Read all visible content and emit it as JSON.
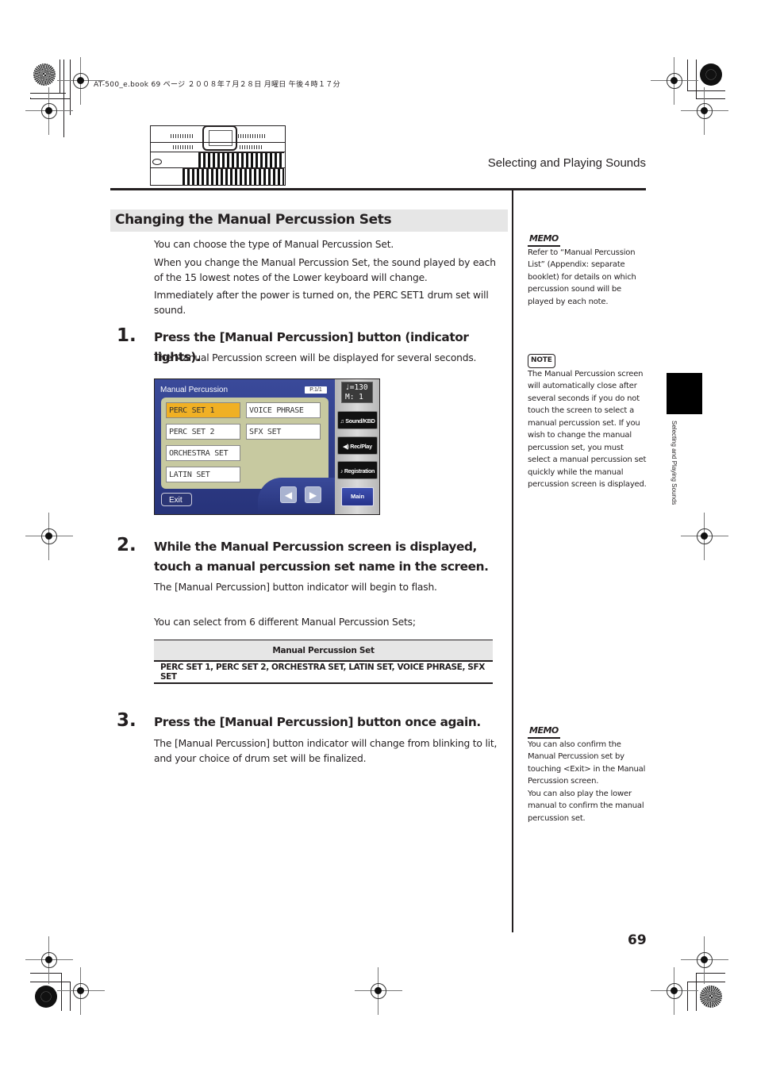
{
  "print_header": {
    "info": "AT-500_e.book  69 ページ  ２００８年７月２８日  月曜日  午後４時１７分"
  },
  "running_head": "Selecting and Playing Sounds",
  "section": {
    "title": "Changing the Manual Percussion Sets",
    "intro": [
      "You can choose the type of Manual Percussion Set.",
      "When you change the Manual Percussion Set, the sound played by each of the 15 lowest notes of the Lower keyboard will change.",
      "Immediately after the power is turned on, the PERC SET1 drum set will sound."
    ]
  },
  "steps": [
    {
      "number": "1.",
      "title": "Press the [Manual Percussion] button (indicator lights).",
      "body": "The Manual Percussion screen will be displayed for several seconds."
    },
    {
      "number": "2.",
      "title": "While the Manual Percussion screen is displayed, touch a manual percussion set name in the screen.",
      "body": "The [Manual Percussion] button indicator will begin to flash.",
      "extra": "You can select from 6 different Manual Percussion Sets;"
    },
    {
      "number": "3.",
      "title": "Press the [Manual Percussion] button once again.",
      "body": "The [Manual Percussion] button indicator will change from blinking to lit, and your choice of drum set will be finalized."
    }
  ],
  "screen": {
    "title": "Manual Percussion",
    "page": "P.1/1",
    "sets_left": [
      "PERC SET 1",
      "PERC SET 2",
      "ORCHESTRA SET",
      "LATIN SET"
    ],
    "sets_right": [
      "VOICE PHRASE",
      "SFX SET"
    ],
    "selected": "PERC SET 1",
    "exit_label": "Exit",
    "prev_icon": "◀",
    "next_icon": "▶",
    "tempo_line": "♩=130",
    "measure_line": "M:   1",
    "side_buttons": [
      "♫ Sound/KBD",
      "◀) Rec/Play",
      "♪ Registration"
    ],
    "main_label": "Main",
    "selected_color": "#f0b024"
  },
  "table": {
    "header": "Manual Percussion Set",
    "row": "PERC SET 1, PERC SET 2, ORCHESTRA SET, LATIN SET, VOICE PHRASE, SFX SET"
  },
  "side_notes": [
    {
      "badge": "MEMO",
      "text": "Refer to “Manual Percussion List” (Appendix: separate booklet) for details on which percussion sound will be played by each note."
    },
    {
      "badge": "NOTE",
      "text": "The Manual Percussion screen will automatically close after several seconds if you do not touch the screen to select a manual percussion set. If you wish to change the manual percussion set, you must select a manual percussion set quickly while the manual percussion screen is displayed."
    },
    {
      "badge": "MEMO",
      "text": "You can also confirm the Manual Percussion set by touching <Exit> in the Manual Percussion screen.\nYou can also play the lower manual to confirm the manual percussion set."
    }
  ],
  "thumb_index": "Selecting and Playing Sounds",
  "page_number": "69"
}
